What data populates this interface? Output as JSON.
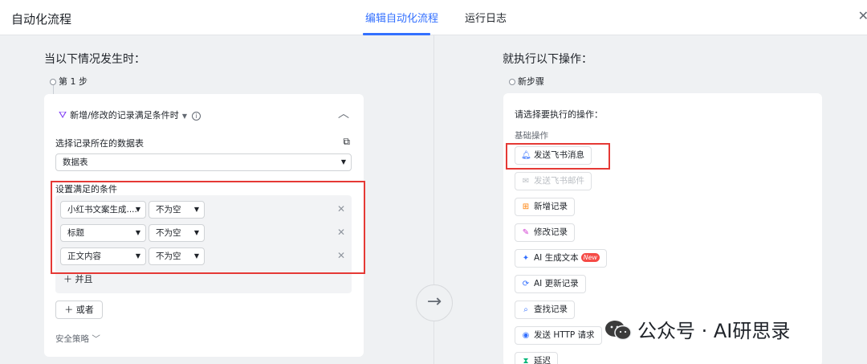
{
  "header": {
    "app_title": "自动化流程",
    "tabs": [
      {
        "label": "编辑自动化流程",
        "active": true
      },
      {
        "label": "运行日志",
        "active": false
      }
    ]
  },
  "left": {
    "section_title": "当以下情况发生时：",
    "step_label": "第 1 步",
    "trigger_label": "新增/修改的记录满足条件时",
    "table_label": "选择记录所在的数据表",
    "table_select": "数据表",
    "conditions_label": "设置满足的条件",
    "conditions": [
      {
        "field": "小红书文案生成....",
        "operator": "不为空"
      },
      {
        "field": "标题",
        "operator": "不为空"
      },
      {
        "field": "正文内容",
        "operator": "不为空"
      }
    ],
    "and_label": "并且",
    "or_label": "或者",
    "security_label": "安全策略"
  },
  "right": {
    "section_title": "就执行以下操作：",
    "step_label": "新步骤",
    "card_title": "请选择要执行的操作：",
    "group_label": "基础操作",
    "actions": [
      {
        "label": "发送飞书消息",
        "icon": "bell-icon",
        "disabled": false
      },
      {
        "label": "发送飞书邮件",
        "icon": "mail-icon",
        "disabled": true
      },
      {
        "label": "新增记录",
        "icon": "add-record-icon",
        "disabled": false
      },
      {
        "label": "修改记录",
        "icon": "edit-icon",
        "disabled": false
      },
      {
        "label": "AI 生成文本",
        "icon": "sparkle-icon",
        "disabled": false,
        "badge": "New"
      },
      {
        "label": "AI 更新记录",
        "icon": "refresh-icon",
        "disabled": false
      },
      {
        "label": "查找记录",
        "icon": "search-icon",
        "disabled": false
      },
      {
        "label": "发送 HTTP 请求",
        "icon": "globe-icon",
        "disabled": false
      },
      {
        "label": "延迟",
        "icon": "hourglass-icon",
        "disabled": false
      }
    ]
  },
  "watermark": {
    "text": "公众号 · AI研思录"
  },
  "colors": {
    "accent": "#3370ff",
    "highlight_box": "#e53935",
    "new_badge": "#f54a45"
  }
}
